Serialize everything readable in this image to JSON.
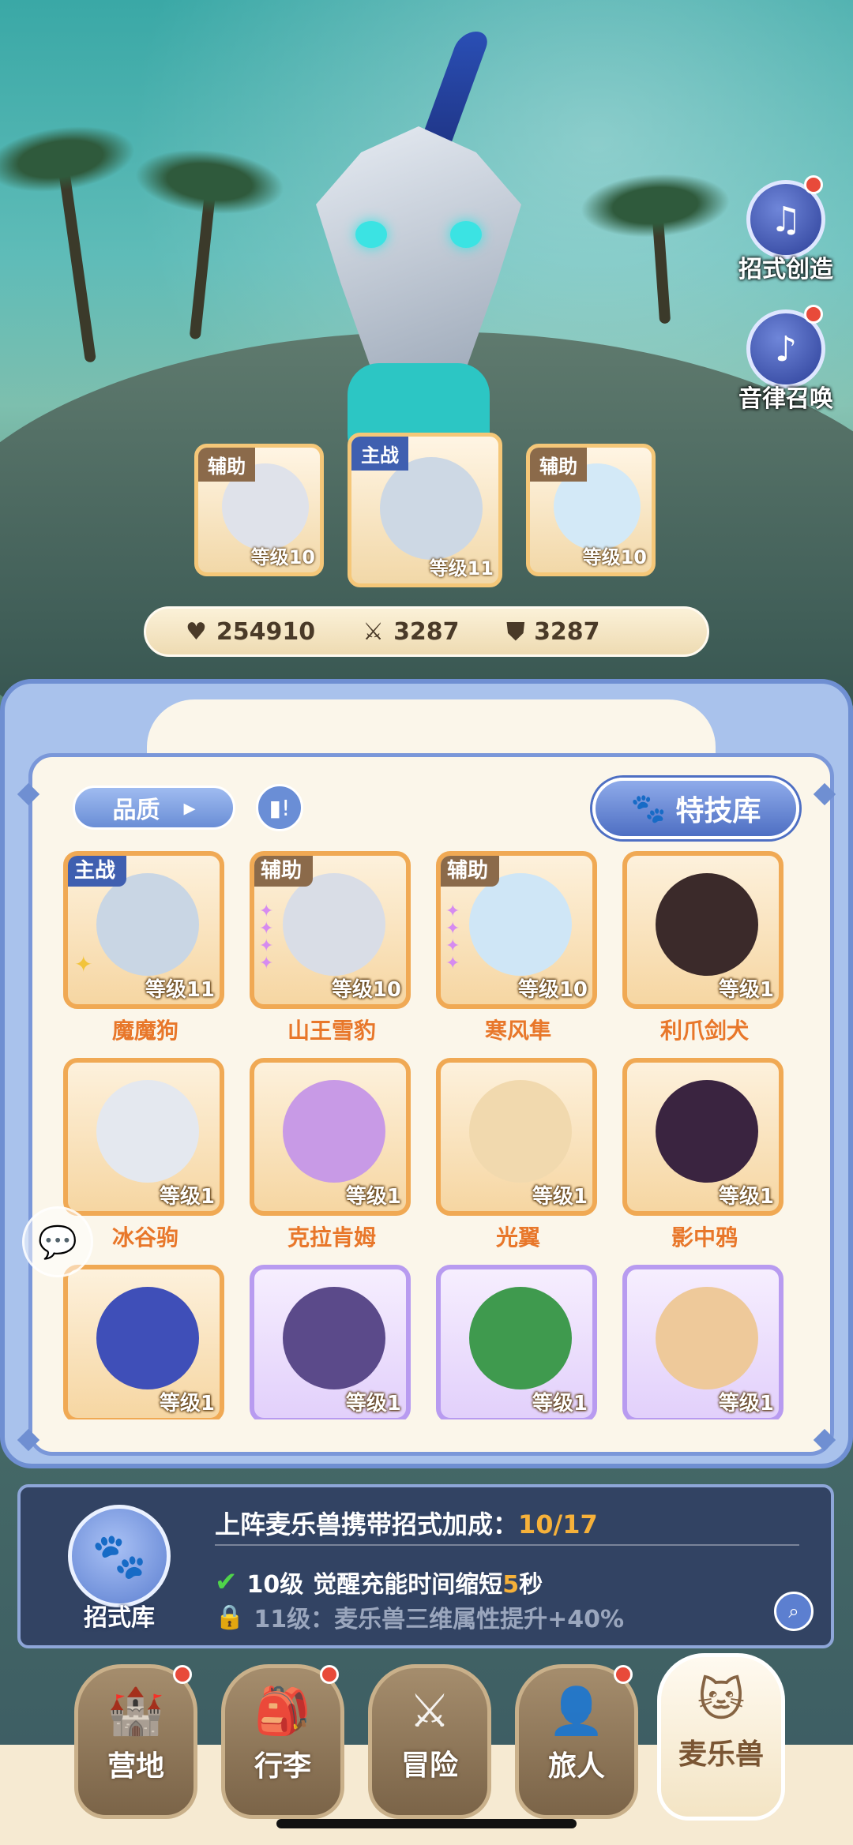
{
  "side_buttons": [
    {
      "label": "招式创造",
      "icon": "book-music-icon",
      "badge": true
    },
    {
      "label": "音律召唤",
      "icon": "lyre-icon",
      "badge": true
    }
  ],
  "team": [
    {
      "tag": "辅助",
      "level": "等级10"
    },
    {
      "tag": "主战",
      "level": "等级11"
    },
    {
      "tag": "辅助",
      "level": "等级10"
    }
  ],
  "stats": {
    "hp": "254910",
    "attack": "3287",
    "defense": "3287"
  },
  "toolbar": {
    "quality_label": "品质",
    "skill_library_label": "特技库"
  },
  "monsters": [
    {
      "name": "魔魔狗",
      "level": "等级11",
      "tag": "主战",
      "rarity": "orange",
      "color": "#c9d6e4"
    },
    {
      "name": "山王雪豹",
      "level": "等级10",
      "tag": "辅助",
      "rarity": "orange",
      "color": "#d9dde6"
    },
    {
      "name": "寒风隼",
      "level": "等级10",
      "tag": "辅助",
      "rarity": "orange",
      "color": "#cfe6f6"
    },
    {
      "name": "利爪剑犬",
      "level": "等级1",
      "tag": "",
      "rarity": "orange",
      "color": "#3b2a2a"
    },
    {
      "name": "冰谷驹",
      "level": "等级1",
      "tag": "",
      "rarity": "orange",
      "color": "#e4e8ef"
    },
    {
      "name": "克拉肯姆",
      "level": "等级1",
      "tag": "",
      "rarity": "orange",
      "color": "#c89ae6"
    },
    {
      "name": "光翼",
      "level": "等级1",
      "tag": "",
      "rarity": "orange",
      "color": "#f1d9ae"
    },
    {
      "name": "影中鸦",
      "level": "等级1",
      "tag": "",
      "rarity": "orange",
      "color": "#3a2440"
    },
    {
      "name": "",
      "level": "等级1",
      "tag": "",
      "rarity": "orange",
      "color": "#3f4fb8"
    },
    {
      "name": "",
      "level": "等级1",
      "tag": "",
      "rarity": "purple",
      "color": "#5b4a8a"
    },
    {
      "name": "",
      "level": "等级1",
      "tag": "",
      "rarity": "purple",
      "color": "#3f9a4e"
    },
    {
      "name": "",
      "level": "等级1",
      "tag": "",
      "rarity": "purple",
      "color": "#eec99a"
    }
  ],
  "bonus": {
    "emblem_label": "招式库",
    "title": "上阵麦乐兽携带招式加成：",
    "progress": "10/17",
    "row1_level": "10级",
    "row1_text": "觉醒充能时间缩短",
    "row1_value": "5",
    "row1_unit": "秒",
    "row2_text": "11级：麦乐兽三维属性提升+40%"
  },
  "nav": [
    {
      "label": "营地",
      "icon": "castle-icon",
      "badge": true,
      "active": false
    },
    {
      "label": "行李",
      "icon": "backpack-icon",
      "badge": true,
      "active": false
    },
    {
      "label": "冒险",
      "icon": "crossed-swords-icon",
      "badge": false,
      "active": false
    },
    {
      "label": "旅人",
      "icon": "traveler-icon",
      "badge": true,
      "active": false
    },
    {
      "label": "麦乐兽",
      "icon": "cat-icon",
      "badge": false,
      "active": true
    }
  ]
}
